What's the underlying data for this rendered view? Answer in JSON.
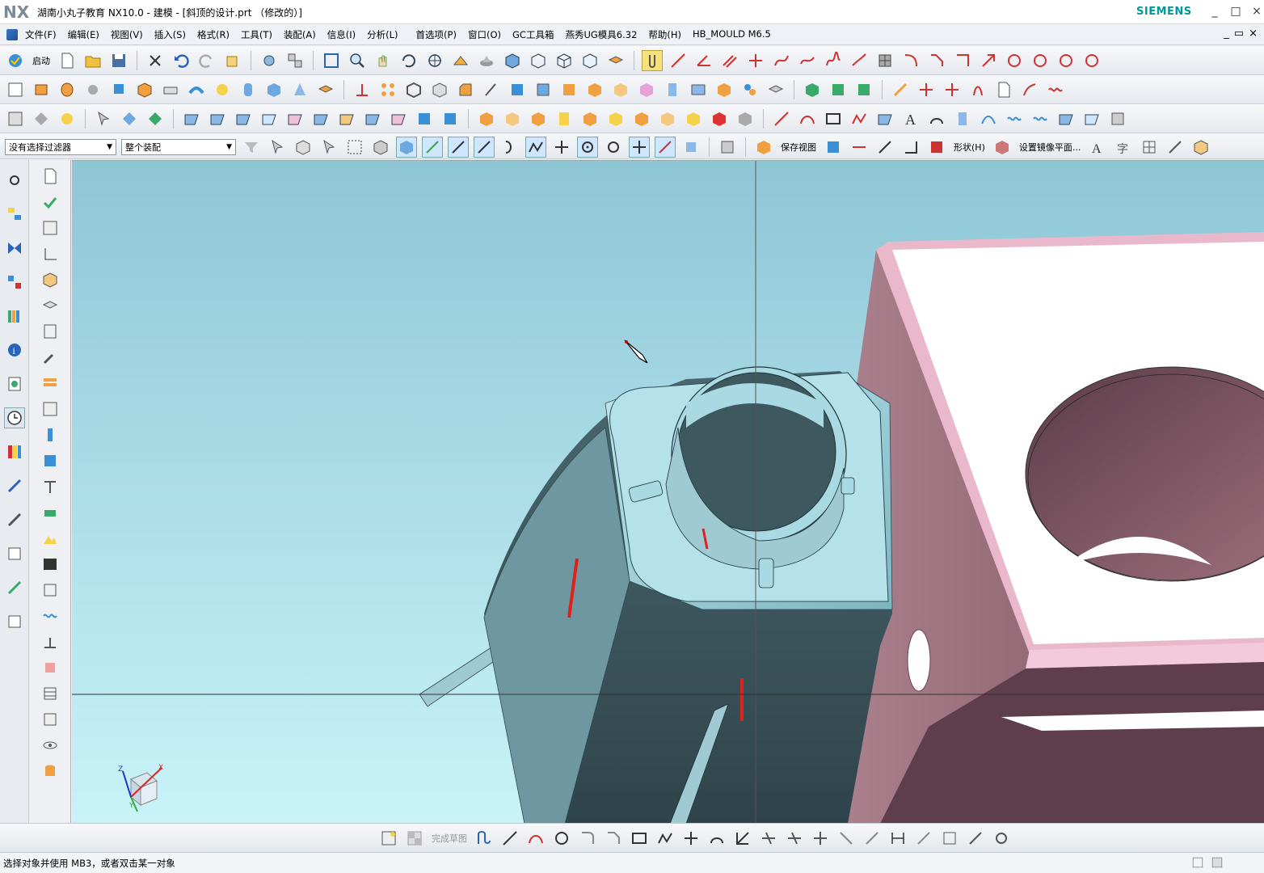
{
  "window": {
    "logo": "NX",
    "title": "湖南小丸子教育 NX10.0 - 建模 - [斜顶的设计.prt （修改的）]",
    "brand": "SIEMENS",
    "controls": [
      "_",
      "□",
      "×"
    ]
  },
  "menu": {
    "items": [
      "文件(F)",
      "编辑(E)",
      "视图(V)",
      "插入(S)",
      "格式(R)",
      "工具(T)",
      "装配(A)",
      "信息(I)",
      "分析(L)",
      "首选项(P)",
      "窗口(O)",
      "GC工具箱",
      "燕秀UG模具6.32",
      "帮助(H)",
      "HB_MOULD M6.5"
    ],
    "right_controls": [
      "_",
      "▭",
      "×"
    ]
  },
  "toolbar": {
    "start_label": "启动",
    "selection_filter": "没有选择过滤器",
    "assembly_scope": "整个装配",
    "save_view_label": "保存视图",
    "shape_label": "形状(H)",
    "mirror_plane_label": "设置镜像平面..."
  },
  "sketch_toolbar": {
    "finish_sketch_label": "完成草图"
  },
  "status": {
    "prompt": "选择对象并使用 MB3，或者双击某一对象"
  },
  "viewport": {
    "triad_labels": {
      "x": "X",
      "y": "Y",
      "z": "Z"
    },
    "colors": {
      "background_top": "#8ec6d6",
      "background_bottom": "#c8f3f8",
      "part_face": "#a9d9e2",
      "part_shadow": "#3e5860",
      "mold_face": "#9c6f7c",
      "mold_top": "#ffffff",
      "mold_edge": "#f3c9dc",
      "marks": "#e0201a"
    }
  }
}
